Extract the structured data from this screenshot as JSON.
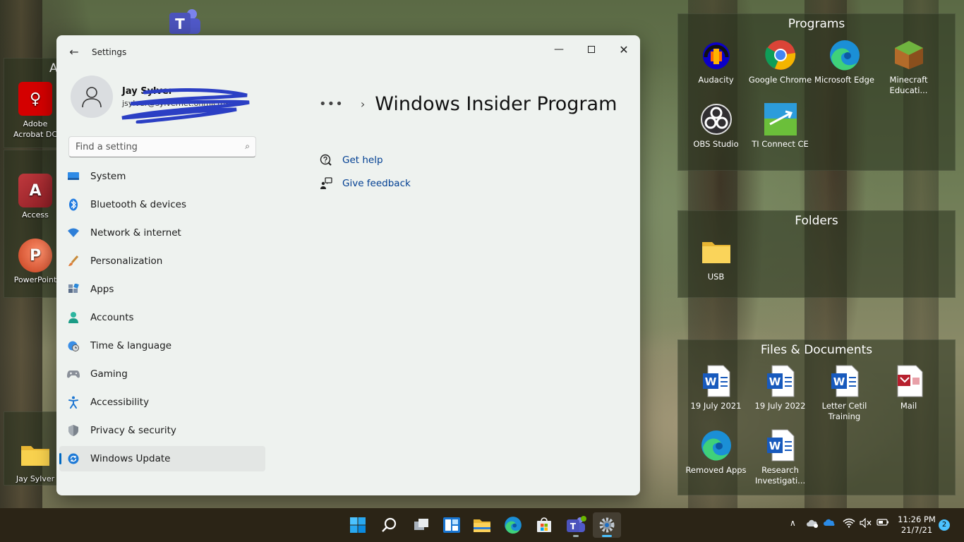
{
  "desktop": {
    "left_icons": [
      {
        "label": "Adobe Acrobat DC",
        "letter": "A",
        "color": "#c00d0d"
      },
      {
        "label": "Access",
        "letter": "A",
        "color": "#a4373a"
      },
      {
        "label": "PowerPoint",
        "letter": "P",
        "color": "#c43e1c"
      },
      {
        "label": "Jay Sylver"
      }
    ],
    "fence_edge_letter": "A",
    "fences": {
      "programs": {
        "title": "Programs",
        "items": [
          "Audacity",
          "Google Chrome",
          "Microsoft Edge",
          "Minecraft Educati...",
          "OBS Studio",
          "TI Connect CE"
        ]
      },
      "folders": {
        "title": "Folders",
        "items": [
          "USB"
        ]
      },
      "files": {
        "title": "Files & Documents",
        "items": [
          "19 July 2021",
          "19 July 2022",
          "Letter Cetil Training",
          "Mail",
          "Removed Apps",
          "Research Investigati..."
        ]
      }
    }
  },
  "settings": {
    "window_title": "Settings",
    "profile": {
      "name": "Jay Sylver",
      "email": "jsylver@sylvernet.onmicrosoft"
    },
    "search": {
      "placeholder": "Find a setting"
    },
    "nav": [
      {
        "label": "System",
        "icon": "system-icon"
      },
      {
        "label": "Bluetooth & devices",
        "icon": "bluetooth-icon"
      },
      {
        "label": "Network & internet",
        "icon": "wifi-icon"
      },
      {
        "label": "Personalization",
        "icon": "brush-icon"
      },
      {
        "label": "Apps",
        "icon": "apps-icon"
      },
      {
        "label": "Accounts",
        "icon": "person-icon"
      },
      {
        "label": "Time & language",
        "icon": "clock-globe-icon"
      },
      {
        "label": "Gaming",
        "icon": "gamepad-icon"
      },
      {
        "label": "Accessibility",
        "icon": "accessibility-icon"
      },
      {
        "label": "Privacy & security",
        "icon": "shield-icon"
      },
      {
        "label": "Windows Update",
        "icon": "update-icon",
        "active": true
      }
    ],
    "breadcrumb_more": "•••",
    "breadcrumb_sep": "›",
    "page_title": "Windows Insider Program",
    "links": [
      {
        "label": "Get help",
        "icon": "help-icon"
      },
      {
        "label": "Give feedback",
        "icon": "feedback-icon"
      }
    ]
  },
  "taskbar": {
    "apps": [
      "start-icon",
      "search-icon",
      "task-view-icon",
      "widgets-icon",
      "file-explorer-icon",
      "edge-icon",
      "store-icon",
      "teams-icon",
      "settings-icon"
    ],
    "clock_time": "11:26 PM",
    "clock_date": "21/7/21",
    "notification_count": "2"
  },
  "colors": {
    "accent": "#0067c0",
    "link": "#003e92",
    "taskbar": "#2b2416"
  }
}
